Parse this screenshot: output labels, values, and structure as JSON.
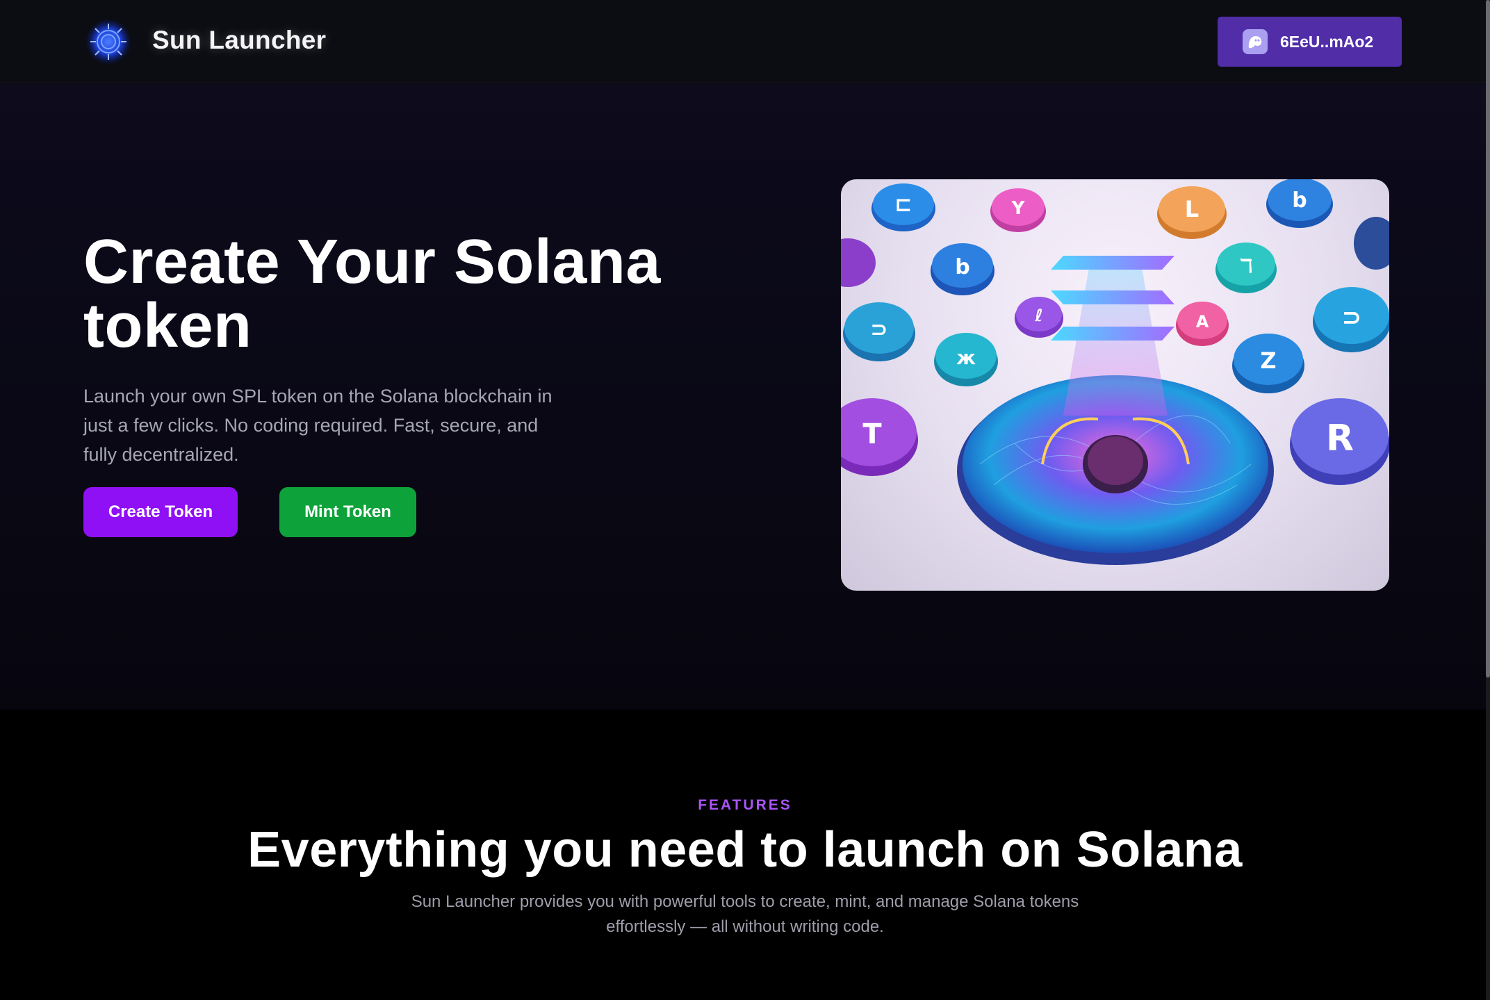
{
  "header": {
    "brand": "Sun Launcher",
    "logo_icon": "sun-logo-icon",
    "wallet": {
      "label": "6EeU..mAo2",
      "icon": "phantom-ghost-icon"
    }
  },
  "hero": {
    "title": "Create Your Solana token",
    "description": "Launch your own SPL token on the Solana blockchain in just a few clicks. No coding required. Fast, secure, and fully decentralized.",
    "buttons": {
      "create": "Create Token",
      "mint": "Mint Token"
    },
    "image_alt": "Solana coins illustration"
  },
  "features": {
    "eyebrow": "FEATURES",
    "title": "Everything you need to launch on Solana",
    "description": "Sun Launcher provides you with powerful tools to create, mint, and manage Solana tokens effortlessly — all without writing code."
  },
  "colors": {
    "create_button": "#9010f5",
    "mint_button": "#0ea33a",
    "wallet_button": "#512da8",
    "accent": "#a855f7",
    "page_background": "#000000"
  }
}
